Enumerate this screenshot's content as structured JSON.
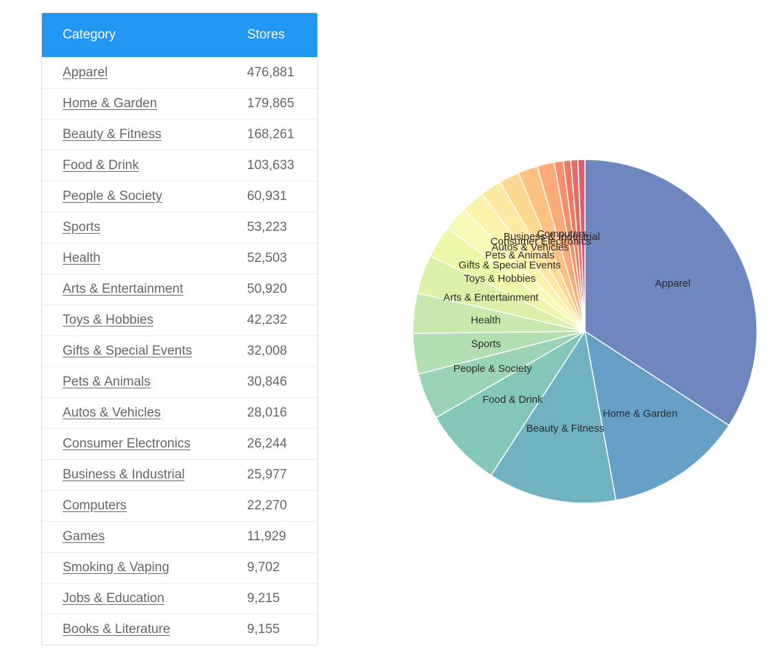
{
  "table": {
    "headers": {
      "category": "Category",
      "stores": "Stores"
    },
    "rows": [
      {
        "category": "Apparel",
        "stores": "476,881"
      },
      {
        "category": "Home & Garden",
        "stores": "179,865"
      },
      {
        "category": "Beauty & Fitness",
        "stores": "168,261"
      },
      {
        "category": "Food & Drink",
        "stores": "103,633"
      },
      {
        "category": "People & Society",
        "stores": "60,931"
      },
      {
        "category": "Sports",
        "stores": "53,223"
      },
      {
        "category": "Health",
        "stores": "52,503"
      },
      {
        "category": "Arts & Entertainment",
        "stores": "50,920"
      },
      {
        "category": "Toys & Hobbies",
        "stores": "42,232"
      },
      {
        "category": "Gifts & Special Events",
        "stores": "32,008"
      },
      {
        "category": "Pets & Animals",
        "stores": "30,846"
      },
      {
        "category": "Autos & Vehicles",
        "stores": "28,016"
      },
      {
        "category": "Consumer Electronics",
        "stores": "26,244"
      },
      {
        "category": "Business & Industrial",
        "stores": "25,977"
      },
      {
        "category": "Computers",
        "stores": "22,270"
      },
      {
        "category": "Games",
        "stores": "11,929"
      },
      {
        "category": "Smoking & Vaping",
        "stores": "9,702"
      },
      {
        "category": "Jobs & Education",
        "stores": "9,215"
      },
      {
        "category": "Books & Literature",
        "stores": "9,155"
      }
    ]
  },
  "chart_data": {
    "type": "pie",
    "title": "",
    "categories": [
      "Apparel",
      "Home & Garden",
      "Beauty & Fitness",
      "Food & Drink",
      "People & Society",
      "Sports",
      "Health",
      "Arts & Entertainment",
      "Toys & Hobbies",
      "Gifts & Special Events",
      "Pets & Animals",
      "Autos & Vehicles",
      "Consumer Electronics",
      "Business & Industrial",
      "Computers",
      "Games",
      "Smoking & Vaping",
      "Jobs & Education",
      "Books & Literature"
    ],
    "values": [
      476881,
      179865,
      168261,
      103633,
      60931,
      53223,
      52503,
      50920,
      42232,
      32008,
      30846,
      28016,
      26244,
      25977,
      22270,
      11929,
      9702,
      9215,
      9155
    ],
    "labeled": [
      true,
      true,
      true,
      true,
      true,
      true,
      true,
      true,
      true,
      true,
      true,
      true,
      true,
      true,
      true,
      false,
      false,
      false,
      false
    ],
    "colors": [
      "#6e88bf",
      "#67a0c6",
      "#6fb3c2",
      "#82c7b8",
      "#9bd4b5",
      "#b2dfb1",
      "#c8e8ad",
      "#dcf0a7",
      "#eef6a8",
      "#f7f9b4",
      "#fbf2ac",
      "#fde9a1",
      "#fdd891",
      "#fdc283",
      "#fba976",
      "#f58e69",
      "#ec7a63",
      "#e16d66",
      "#d5636e"
    ],
    "start": "12 o'clock, clockwise",
    "legend": "none"
  }
}
